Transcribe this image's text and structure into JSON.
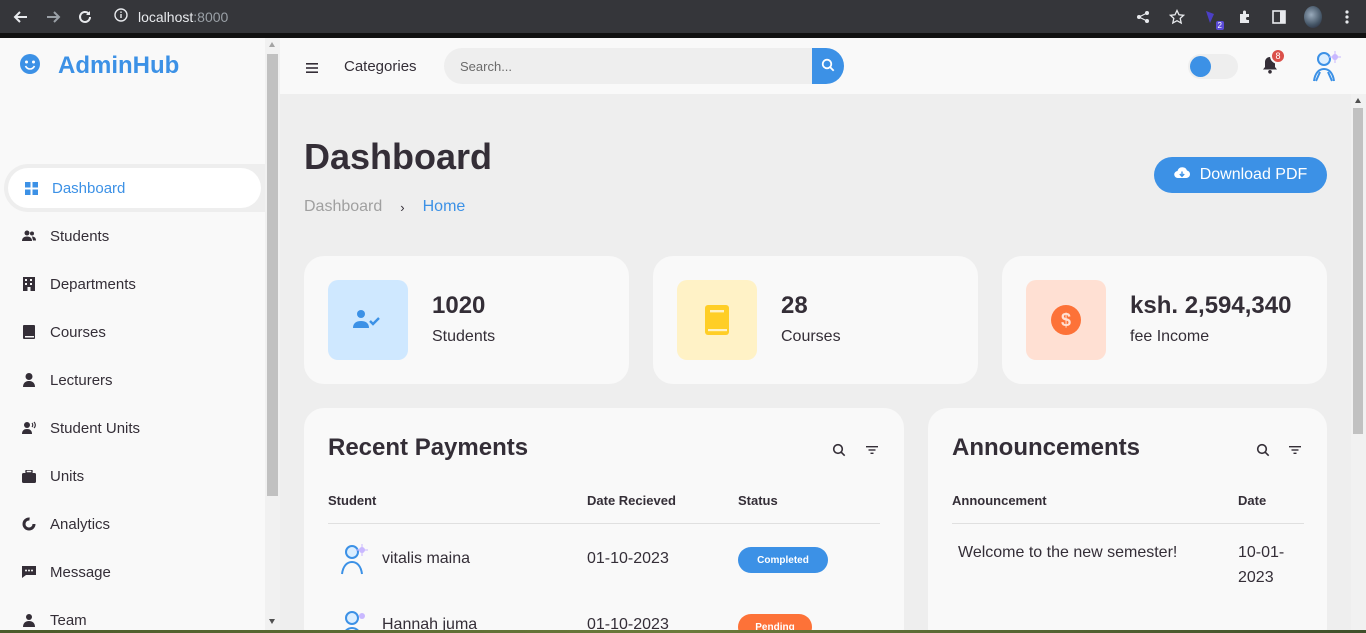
{
  "browser": {
    "url_host": "localhost",
    "url_port": ":8000",
    "ext_badge": "2"
  },
  "brand": {
    "title": "AdminHub"
  },
  "sidebar": {
    "items": [
      {
        "label": "Dashboard",
        "icon": "dashboard-icon",
        "active": true
      },
      {
        "label": "Students",
        "icon": "group-icon"
      },
      {
        "label": "Departments",
        "icon": "building-icon"
      },
      {
        "label": "Courses",
        "icon": "book-icon"
      },
      {
        "label": "Lecturers",
        "icon": "user-icon"
      },
      {
        "label": "Student Units",
        "icon": "user-voice-icon"
      },
      {
        "label": "Units",
        "icon": "briefcase-icon"
      },
      {
        "label": "Analytics",
        "icon": "doughnut-chart-icon"
      },
      {
        "label": "Message",
        "icon": "message-dots-icon"
      },
      {
        "label": "Team",
        "icon": "team-icon"
      }
    ]
  },
  "topnav": {
    "categories_label": "Categories",
    "search_placeholder": "Search...",
    "notification_count": "8"
  },
  "main": {
    "title": "Dashboard",
    "breadcrumb": {
      "first": "Dashboard",
      "separator": "›",
      "current": "Home"
    },
    "download_label": "Download PDF",
    "stats": [
      {
        "value": "1020",
        "label": "Students",
        "icon": "user-check-icon",
        "bg": "#cfe8ff",
        "fg": "#3c91e6"
      },
      {
        "value": "28",
        "label": "Courses",
        "icon": "book-icon",
        "bg": "#fff2c6",
        "fg": "#ffce26"
      },
      {
        "value": "ksh. 2,594,340",
        "label": "fee Income",
        "icon": "dollar-circle-icon",
        "bg": "#ffe0d3",
        "fg": "#fd7238"
      }
    ],
    "payments": {
      "title": "Recent Payments",
      "headers": [
        "Student",
        "Date Recieved",
        "Status"
      ],
      "rows": [
        {
          "student": "vitalis maina",
          "date": "01-10-2023",
          "status": "Completed",
          "status_color": "#3c91e6"
        },
        {
          "student": "Hannah juma",
          "date": "01-10-2023",
          "status": "Pending",
          "status_color": "#fd7238"
        }
      ]
    },
    "announcements": {
      "title": "Announcements",
      "headers": [
        "Announcement",
        "Date"
      ],
      "rows": [
        {
          "text": "Welcome to the new semester!",
          "date_line1": "10-01-",
          "date_line2": "2023"
        }
      ]
    }
  },
  "colors": {
    "accent": "#3c91e6",
    "dark": "#342e37",
    "light": "#f9f9f9",
    "grey": "#eeeeee",
    "orange": "#fd7238",
    "yellow": "#ffce26",
    "red": "#db504a"
  }
}
